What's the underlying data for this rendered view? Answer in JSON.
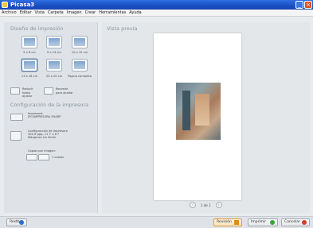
{
  "window": {
    "title": "Picasa3"
  },
  "menu": [
    "Archivo",
    "Editar",
    "Vista",
    "Carpeta",
    "Imagen",
    "Crear",
    "Herramientas",
    "Ayuda"
  ],
  "left": {
    "layout_title": "Diseño de impresión",
    "layouts": [
      {
        "label": "5 x 8 cm",
        "selected": false
      },
      {
        "label": "9 x 13 cm",
        "selected": false
      },
      {
        "label": "10 x 15 cm",
        "selected": false
      },
      {
        "label": "13 x 18 cm",
        "selected": true
      },
      {
        "label": "20 x 25 cm",
        "selected": false
      },
      {
        "label": "Página completa",
        "selected": false
      }
    ],
    "reduce_label": "Reducir hasta ajustar",
    "crop_label": "Recortar para ajustar",
    "printer_title": "Configuración de la impresora",
    "printer_label": "Impresora:",
    "printer_name": "\\PC\\IMPRESORA SHARP",
    "config_title": "Configuración de impresora",
    "config_line1": "300 X ppp, 11 ?' x 8 ?",
    "config_line2": "Márgenes sin límite",
    "copies_title": "Copias por imagen:",
    "copies_value": "1 copias"
  },
  "preview": {
    "title": "Vista previa",
    "page_label": "1 de 1"
  },
  "bottom": {
    "reset": "Restb",
    "review": "Revisión",
    "print": "Imprimir",
    "cancel": "Cancelar"
  }
}
